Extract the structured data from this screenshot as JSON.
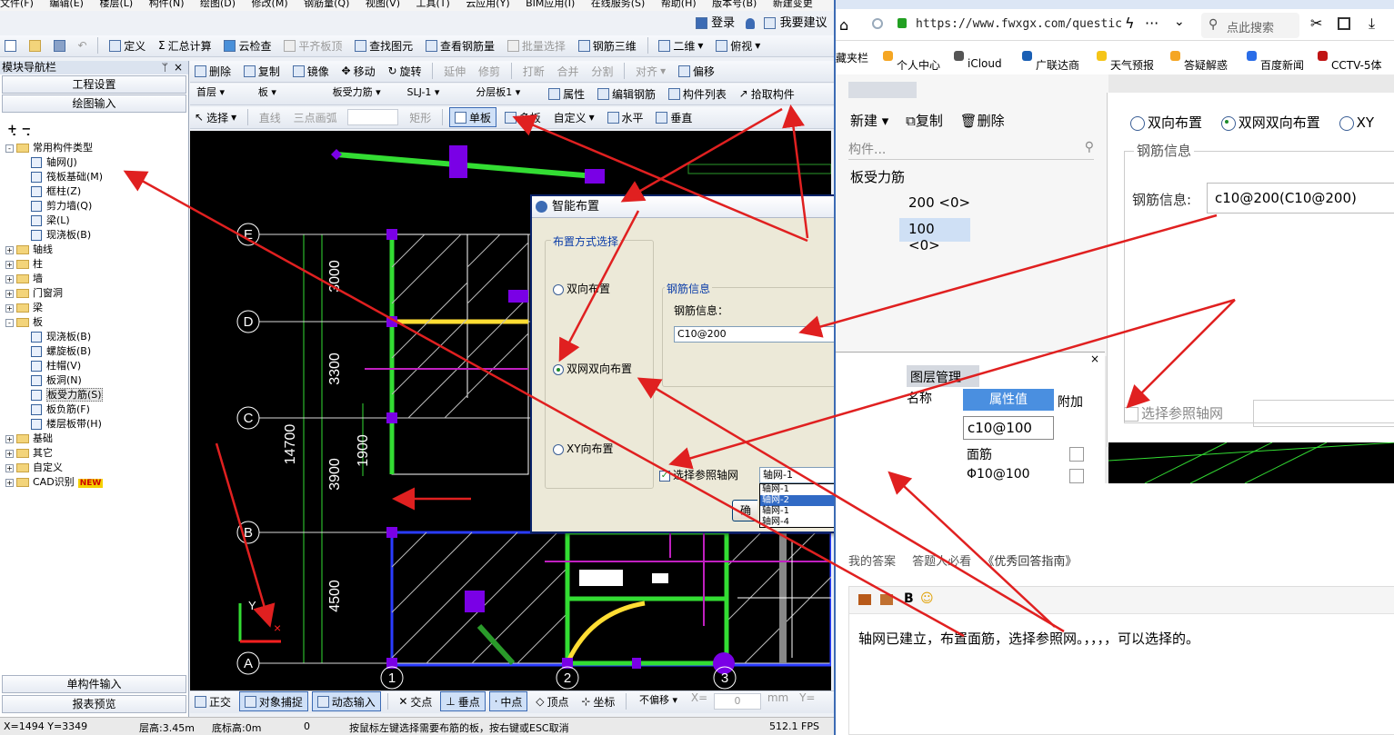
{
  "menu": {
    "items": [
      "文件(F)",
      "编辑(E)",
      "楼层(L)",
      "构件(N)",
      "绘图(D)",
      "修改(M)",
      "钢筋量(Q)",
      "视图(V)",
      "工具(T)",
      "云应用(Y)",
      "BIM应用(I)",
      "在线服务(S)",
      "帮助(H)",
      "版本号(B)",
      "新建变更"
    ]
  },
  "topright": {
    "login": "登录",
    "suggest": "我要建议"
  },
  "toolbar1": {
    "define": "定义",
    "sum": "汇总计算",
    "cloud": "云检查",
    "flat": "平齐板顶",
    "find": "查找图元",
    "view_rebar": "查看钢筋量",
    "batch": "批量选择",
    "rebar3d": "钢筋三维",
    "mode2d": "二维",
    "view": "俯视"
  },
  "toolbar2": {
    "delete": "删除",
    "copy": "复制",
    "mirror": "镜像",
    "move": "移动",
    "rotate": "旋转",
    "extend": "延伸",
    "trim": "修剪",
    "break": "打断",
    "merge": "合并",
    "split": "分割",
    "align": "对齐",
    "offset": "偏移"
  },
  "toolbar3": {
    "floor": "首层",
    "category": "板",
    "type": "板受力筋",
    "name": "SLJ-1",
    "layer": "分层板1",
    "props": "属性",
    "edit_rebar": "编辑钢筋",
    "list": "构件列表",
    "pick": "拾取构件"
  },
  "toolbar4": {
    "select": "选择",
    "line": "直线",
    "arc": "三点画弧",
    "rect": "矩形",
    "single": "单板",
    "multi": "多板",
    "custom": "自定义",
    "horizontal": "水平",
    "vertical": "垂直"
  },
  "nav": {
    "title": "模块导航栏",
    "project_settings": "工程设置",
    "drawing_input": "绘图输入",
    "single_input": "单构件输入",
    "report": "报表预览",
    "tree": [
      {
        "label": "常用构件类型",
        "level": 0,
        "kind": "folder",
        "exp": "-"
      },
      {
        "label": "轴网(J)",
        "level": 1,
        "kind": "item"
      },
      {
        "label": "筏板基础(M)",
        "level": 1,
        "kind": "item"
      },
      {
        "label": "框柱(Z)",
        "level": 1,
        "kind": "item"
      },
      {
        "label": "剪力墙(Q)",
        "level": 1,
        "kind": "item"
      },
      {
        "label": "梁(L)",
        "level": 1,
        "kind": "item"
      },
      {
        "label": "现浇板(B)",
        "level": 1,
        "kind": "item"
      },
      {
        "label": "轴线",
        "level": 0,
        "kind": "folder",
        "exp": "+"
      },
      {
        "label": "柱",
        "level": 0,
        "kind": "folder",
        "exp": "+"
      },
      {
        "label": "墙",
        "level": 0,
        "kind": "folder",
        "exp": "+"
      },
      {
        "label": "门窗洞",
        "level": 0,
        "kind": "folder",
        "exp": "+"
      },
      {
        "label": "梁",
        "level": 0,
        "kind": "folder",
        "exp": "+"
      },
      {
        "label": "板",
        "level": 0,
        "kind": "folder",
        "exp": "-"
      },
      {
        "label": "现浇板(B)",
        "level": 1,
        "kind": "item"
      },
      {
        "label": "螺旋板(B)",
        "level": 1,
        "kind": "item"
      },
      {
        "label": "柱帽(V)",
        "level": 1,
        "kind": "item"
      },
      {
        "label": "板洞(N)",
        "level": 1,
        "kind": "item"
      },
      {
        "label": "板受力筋(S)",
        "level": 1,
        "kind": "item",
        "selected": true
      },
      {
        "label": "板负筋(F)",
        "level": 1,
        "kind": "item"
      },
      {
        "label": "楼层板带(H)",
        "level": 1,
        "kind": "item"
      },
      {
        "label": "基础",
        "level": 0,
        "kind": "folder",
        "exp": "+"
      },
      {
        "label": "其它",
        "level": 0,
        "kind": "folder",
        "exp": "+"
      },
      {
        "label": "自定义",
        "level": 0,
        "kind": "folder",
        "exp": "+"
      },
      {
        "label": "CAD识别",
        "level": 0,
        "kind": "folder",
        "exp": "+",
        "badge": "NEW"
      }
    ]
  },
  "canvas": {
    "rows": [
      "E",
      "D",
      "C",
      "B",
      "A"
    ],
    "cols": [
      "1",
      "2",
      "3"
    ],
    "dims": [
      "3000",
      "3300",
      "3900",
      "4500"
    ],
    "total": "14700",
    "inner": "1900",
    "bottom_dim": "3000",
    "axis_y": "Y"
  },
  "dialog": {
    "title": "智能布置",
    "mode_group": "布置方式选择",
    "options": [
      "双向布置",
      "双网双向布置",
      "XY向布置"
    ],
    "selected_option": "双网双向布置",
    "rebar_group": "钢筋信息",
    "rebar_label": "钢筋信息：",
    "rebar_value": "C10@200",
    "ref_checkbox": "选择参照轴网",
    "ref_checked": true,
    "ref_value": "轴网-1",
    "ref_options": [
      "轴网-1",
      "轴网-2",
      "轴网-1",
      "轴网-4"
    ],
    "ok_button": "确"
  },
  "bottom": {
    "ortho": "正交",
    "snap": "对象捕捉",
    "dyn": "动态输入",
    "cross": "交点",
    "perp": "垂点",
    "mid": "中点",
    "vertex": "顶点",
    "coord": "坐标",
    "nooffset": "不偏移",
    "x_label": "X=",
    "x_val": "0",
    "mm": "mm",
    "y_label": "Y="
  },
  "status": {
    "xy": "X=1494 Y=3349",
    "floor_h": "层高:3.45m",
    "base_h": "底标高:0m",
    "zero": "0",
    "hint": "按鼠标左键选择需要布筋的板，按右键或ESC取消",
    "fps": "512.1 FPS"
  },
  "browser": {
    "url": "https://www.fwxgx.com/questic",
    "search_placeholder": "点此搜索",
    "bookmarks": [
      "藏夹栏",
      "个人中心",
      "iCloud",
      "广联达商",
      "天气预报",
      "答疑解惑",
      "百度新闻",
      "CCTV-5体"
    ],
    "embed": {
      "new": "新建",
      "copy": "复制",
      "delete": "删除",
      "search_placeholder": "构件...",
      "list_title": "板受力筋",
      "items": [
        "200 <0>",
        "100 <0>"
      ],
      "opt1": "双向布置",
      "opt2": "双网双向布置",
      "opt3": "XY",
      "group": "钢筋信息",
      "rebar_label": "钢筋信息:",
      "rebar_value": "c10@200(C10@200)",
      "ref_label": "选择参照轴网",
      "tab_layer": "图层管理",
      "col_name": "名称",
      "col_value": "属性值",
      "col_extra": "附加",
      "rows": [
        "c10@100",
        "面筋",
        "Φ10@100"
      ]
    },
    "answer_links": [
      "我的答案",
      "答题人必看",
      "《优秀回答指南》"
    ],
    "answer_text": "轴网已建立，布置面筋，选择参照网。，，，，可以选择的。"
  },
  "colors": {
    "accent": "#3c6bb4",
    "annot": "#e02020",
    "cad_green": "#33dd33",
    "cad_purple": "#7a00e6"
  }
}
